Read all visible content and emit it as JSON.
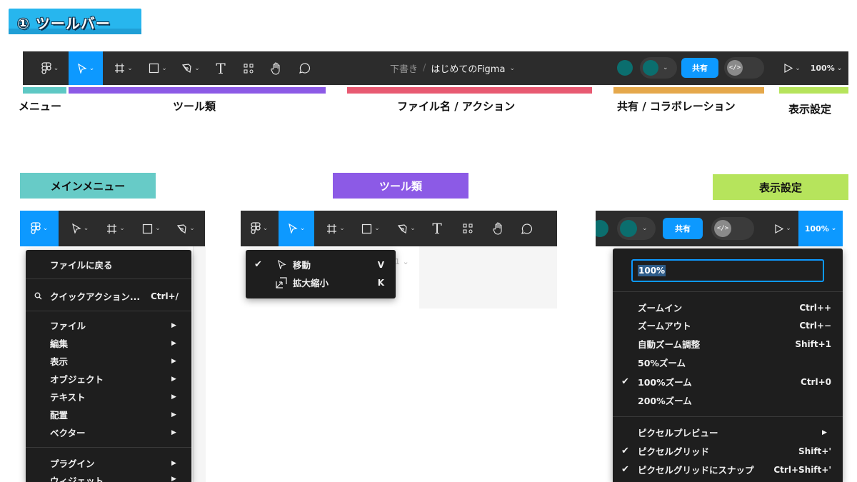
{
  "section_title": "① ツールバー",
  "toolbar": {
    "file_draft": "下書き",
    "file_slash": "/",
    "file_name": "はじめてのFigma",
    "share_label": "共有",
    "zoom": "100%",
    "text_tool": "T"
  },
  "annotations": [
    {
      "label": "メニュー",
      "color": "#5ec8c4"
    },
    {
      "label": "ツール類",
      "color": "#8c5ae6"
    },
    {
      "label": "ファイル名 / アクション",
      "color": "#e85a72"
    },
    {
      "label": "共有 / コラボレーション",
      "color": "#e5a84b"
    },
    {
      "label": "表示設定",
      "color": "#b6e45c"
    }
  ],
  "tags": {
    "main_menu": "メインメニュー",
    "tools": "ツール類",
    "view": "表示設定"
  },
  "tag_colors": {
    "main_menu": "#67cbc7",
    "tools": "#8c5ae6",
    "view": "#b6e45c"
  },
  "main_menu": {
    "back": "ファイルに戻る",
    "quick_action": "クイックアクション...",
    "quick_action_shortcut": "Ctrl+/",
    "items": [
      "ファイル",
      "編集",
      "表示",
      "オブジェクト",
      "テキスト",
      "配置",
      "ベクター"
    ],
    "plugins": [
      "プラグイン",
      "ウィジェット"
    ]
  },
  "tool_menu": {
    "items": [
      {
        "label": "移動",
        "shortcut": "V",
        "checked": true
      },
      {
        "label": "拡大縮小",
        "shortcut": "K",
        "checked": false
      }
    ],
    "peek_text": "1 ⌄"
  },
  "zoom_menu": {
    "input_value": "100%",
    "items": [
      {
        "label": "ズームイン",
        "shortcut": "Ctrl++",
        "checked": false
      },
      {
        "label": "ズームアウト",
        "shortcut": "Ctrl+−",
        "checked": false
      },
      {
        "label": "自動ズーム調整",
        "shortcut": "Shift+1",
        "checked": false
      },
      {
        "label": "50%ズーム",
        "shortcut": "",
        "checked": false
      },
      {
        "label": "100%ズーム",
        "shortcut": "Ctrl+0",
        "checked": true
      },
      {
        "label": "200%ズーム",
        "shortcut": "",
        "checked": false
      }
    ],
    "pixel_items": [
      {
        "label": "ピクセルプレビュー",
        "shortcut": "",
        "checked": false,
        "submenu": true
      },
      {
        "label": "ピクセルグリッド",
        "shortcut": "Shift+'",
        "checked": true,
        "submenu": false
      },
      {
        "label": "ピクセルグリッドにスナップ",
        "shortcut": "Ctrl+Shift+'",
        "checked": true,
        "submenu": false
      }
    ]
  },
  "glyphs": {
    "arrow": "▶",
    "check": "✔",
    "chevron": "⌄"
  }
}
